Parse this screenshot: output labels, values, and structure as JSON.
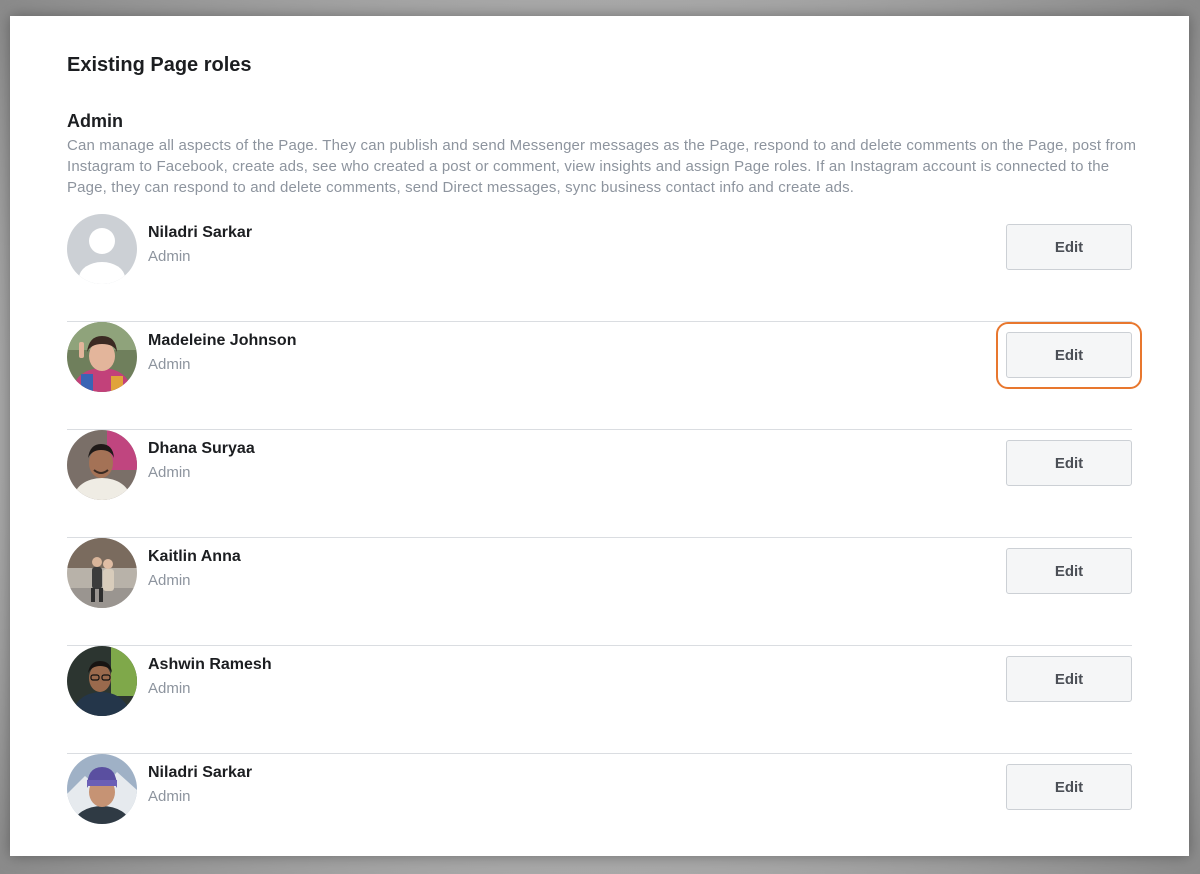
{
  "page": {
    "heading": "Existing Page roles"
  },
  "section": {
    "title": "Admin",
    "description": "Can manage all aspects of the Page. They can publish and send Messenger messages as the Page, respond to and delete comments on the Page, post from Instagram to Facebook, create ads, see who created a post or comment, view insights and assign Page roles. If an Instagram account is connected to the Page, they can respond to and delete comments, send Direct messages, sync business contact info and create ads."
  },
  "members": [
    {
      "name": "Niladri Sarkar",
      "role": "Admin",
      "edit_label": "Edit",
      "avatar": "default-silhouette"
    },
    {
      "name": "Madeleine Johnson",
      "role": "Admin",
      "edit_label": "Edit",
      "avatar": "profile-photo",
      "highlighted": true
    },
    {
      "name": "Dhana Suryaa",
      "role": "Admin",
      "edit_label": "Edit",
      "avatar": "profile-photo"
    },
    {
      "name": "Kaitlin Anna",
      "role": "Admin",
      "edit_label": "Edit",
      "avatar": "profile-photo"
    },
    {
      "name": "Ashwin Ramesh",
      "role": "Admin",
      "edit_label": "Edit",
      "avatar": "profile-photo"
    },
    {
      "name": "Niladri Sarkar",
      "role": "Admin",
      "edit_label": "Edit",
      "avatar": "profile-photo"
    }
  ],
  "colors": {
    "highlight": "#e8772e",
    "muted_text": "#8d949e",
    "divider": "#dadde1",
    "button_bg": "#f5f6f7"
  }
}
